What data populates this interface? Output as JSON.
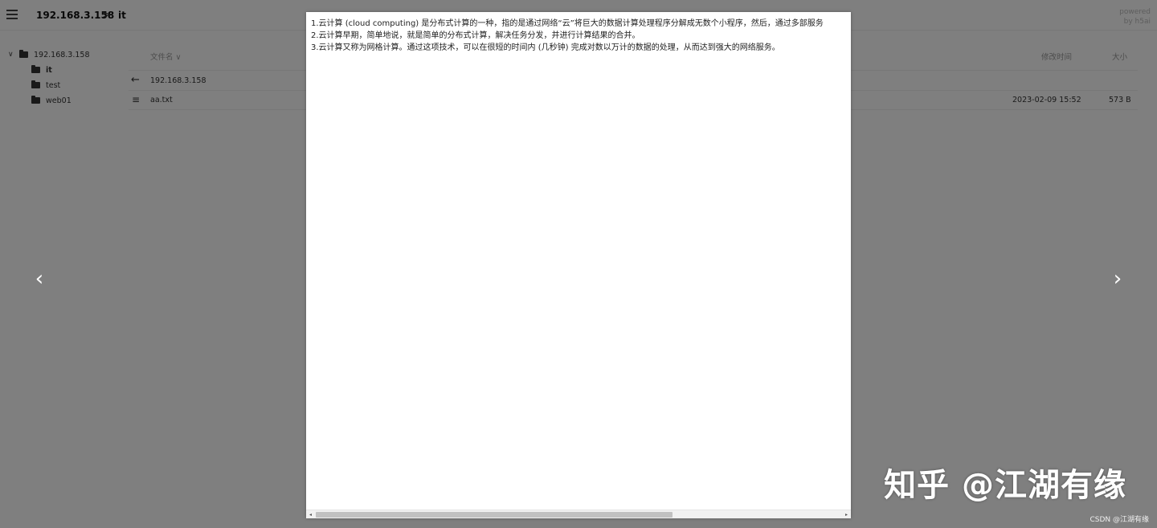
{
  "header": {
    "breadcrumb_root": "192.168.3.158",
    "breadcrumb_separator": ">",
    "breadcrumb_current": "it",
    "powered_line1": "powered",
    "powered_line2": "by h5ai",
    "icons": {
      "menu": "hamburger-menu-icon"
    }
  },
  "tree": {
    "root": {
      "label": "192.168.3.158",
      "expanded": true
    },
    "children": [
      {
        "label": "it",
        "active": true
      },
      {
        "label": "test",
        "active": false
      },
      {
        "label": "web01",
        "active": false
      }
    ]
  },
  "file_table": {
    "columns": {
      "name": "文件名 ∨",
      "modified": "修改时间",
      "size": "大小"
    },
    "rows": [
      {
        "icon": "back-arrow-icon",
        "name": "192.168.3.158",
        "modified": "",
        "size": ""
      },
      {
        "icon": "text-file-icon",
        "name": "aa.txt",
        "modified": "2023-02-09 15:52",
        "size": "573 B"
      }
    ]
  },
  "preview": {
    "lines": [
      "1.云计算 (cloud computing) 是分布式计算的一种，指的是通过网络“云”将巨大的数据计算处理程序分解成无数个小程序，然后，通过多部服务",
      "2.云计算早期，简单地说，就是简单的分布式计算，解决任务分发，并进行计算结果的合并。",
      "3.云计算又称为网格计算。通过这项技术，可以在很短的时间内 (几秒钟) 完成对数以万计的数据的处理，从而达到强大的网络服务。"
    ],
    "nav": {
      "prev": "‹",
      "next": "›"
    },
    "scrollbar": {
      "left_arrow": "◂",
      "right_arrow": "▸"
    }
  },
  "watermark": {
    "text": "知乎 @江湖有缘",
    "credit": "CSDN @江湖有缘"
  },
  "colors": {
    "overlay": "#000000",
    "modal_bg": "#ffffff",
    "scroll_thumb": "#c1c1c1"
  }
}
